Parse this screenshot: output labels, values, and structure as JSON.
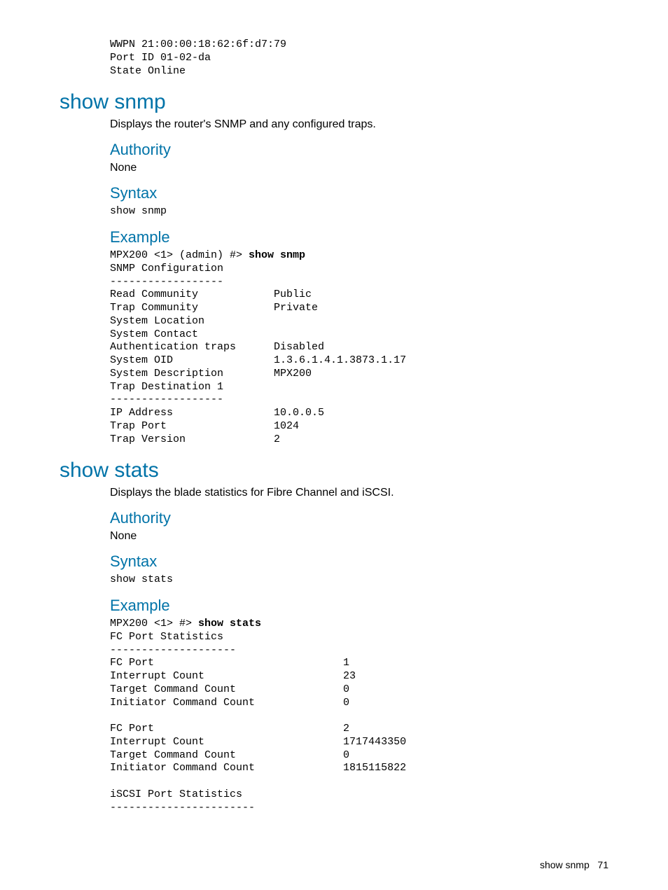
{
  "top_block": "WWPN 21:00:00:18:62:6f:d7:79\nPort ID 01-02-da\nState Online",
  "sections": {
    "snmp": {
      "title": "show snmp",
      "desc": "Displays the router's SNMP and any configured traps.",
      "authority_h": "Authority",
      "authority_v": "None",
      "syntax_h": "Syntax",
      "syntax_v": "show snmp",
      "example_h": "Example",
      "prompt": "MPX200 <1> (admin) #> ",
      "cmd": "show snmp",
      "output": "\nSNMP Configuration\n------------------\nRead Community            Public\nTrap Community            Private\nSystem Location\nSystem Contact\nAuthentication traps      Disabled\nSystem OID                1.3.6.1.4.1.3873.1.17\nSystem Description        MPX200\nTrap Destination 1\n------------------\nIP Address                10.0.0.5\nTrap Port                 1024\nTrap Version              2"
    },
    "stats": {
      "title": "show stats",
      "desc": "Displays the blade statistics for Fibre Channel and iSCSI.",
      "authority_h": "Authority",
      "authority_v": "None",
      "syntax_h": "Syntax",
      "syntax_v": "show stats",
      "example_h": "Example",
      "prompt": "MPX200 <1> #> ",
      "cmd": "show stats",
      "output": "\nFC Port Statistics\n--------------------\nFC Port                              1\nInterrupt Count                      23\nTarget Command Count                 0\nInitiator Command Count              0\n\nFC Port                              2\nInterrupt Count                      1717443350\nTarget Command Count                 0\nInitiator Command Count              1815115822\n\niSCSI Port Statistics\n-----------------------"
    }
  },
  "footer": {
    "label": "show snmp",
    "page": "71"
  },
  "chart_data": {
    "type": "table",
    "tables": [
      {
        "title": "SNMP Configuration",
        "rows": [
          [
            "Read Community",
            "Public"
          ],
          [
            "Trap Community",
            "Private"
          ],
          [
            "System Location",
            ""
          ],
          [
            "System Contact",
            ""
          ],
          [
            "Authentication traps",
            "Disabled"
          ],
          [
            "System OID",
            "1.3.6.1.4.1.3873.1.17"
          ],
          [
            "System Description",
            "MPX200"
          ]
        ]
      },
      {
        "title": "Trap Destination 1",
        "rows": [
          [
            "IP Address",
            "10.0.0.5"
          ],
          [
            "Trap Port",
            "1024"
          ],
          [
            "Trap Version",
            "2"
          ]
        ]
      },
      {
        "title": "FC Port Statistics",
        "groups": [
          {
            "rows": [
              [
                "FC Port",
                1
              ],
              [
                "Interrupt Count",
                23
              ],
              [
                "Target Command Count",
                0
              ],
              [
                "Initiator Command Count",
                0
              ]
            ]
          },
          {
            "rows": [
              [
                "FC Port",
                2
              ],
              [
                "Interrupt Count",
                1717443350
              ],
              [
                "Target Command Count",
                0
              ],
              [
                "Initiator Command Count",
                1815115822
              ]
            ]
          }
        ]
      }
    ]
  }
}
